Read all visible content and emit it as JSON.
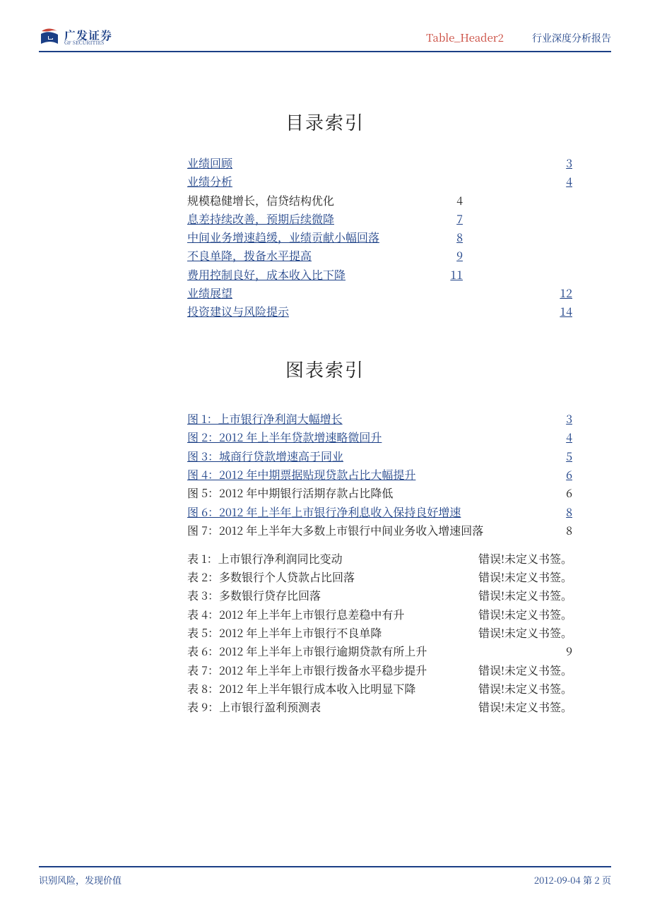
{
  "header": {
    "logo_cn": "广发证券",
    "logo_en": "GF SECURITIES",
    "table_tag": "Table_Header2",
    "category": "行业深度分析报告"
  },
  "titles": {
    "toc": "目录索引",
    "figs": "图表索引"
  },
  "toc_main": [
    {
      "label": "业绩回顾",
      "page": "3",
      "link": true,
      "wide": true
    },
    {
      "label": "业绩分析",
      "page": "4",
      "link": true,
      "wide": true
    }
  ],
  "toc_sub": [
    {
      "label": "规模稳健增长，信贷结构优化",
      "page": "4",
      "link": false
    },
    {
      "label": "息差持续改善，预期后续微降",
      "page": "7",
      "link": true
    },
    {
      "label": "中间业务增速趋缓，业绩贡献小幅回落",
      "page": "8",
      "link": true
    },
    {
      "label": "不良单降，拨备水平提高",
      "page": "9",
      "link": true
    },
    {
      "label": "费用控制良好，成本收入比下降",
      "page": "11",
      "link": true
    }
  ],
  "toc_tail": [
    {
      "label": "业绩展望",
      "page": "12",
      "link": true,
      "wide": true
    },
    {
      "label": "投资建议与风险提示",
      "page": "14",
      "link": true,
      "wide": true
    }
  ],
  "figures": [
    {
      "label": "图 1：上市银行净利润大幅增长",
      "page": "3",
      "link": true
    },
    {
      "label": "图 2：2012 年上半年贷款增速略微回升",
      "page": "4",
      "link": true
    },
    {
      "label": "图 3：城商行贷款增速高于同业",
      "page": "5",
      "link": true
    },
    {
      "label": "图 4：2012 年中期票据贴现贷款占比大幅提升",
      "page": "6",
      "link": true
    },
    {
      "label": "图 5：2012 年中期银行活期存款占比降低",
      "page": "6",
      "link": false
    },
    {
      "label": "图 6：2012 年上半年上市银行净利息收入保持良好增速",
      "page": "8",
      "link": true
    },
    {
      "label": "图 7：2012 年上半年大多数上市银行中间业务收入增速回落",
      "page": "8",
      "link": false
    }
  ],
  "tables": [
    {
      "label": "表 1：上市银行净利润同比变动",
      "page": "错误!未定义书签。",
      "link": false
    },
    {
      "label": "表 2：多数银行个人贷款占比回落",
      "page": "错误!未定义书签。",
      "link": false
    },
    {
      "label": "表 3：多数银行贷存比回落",
      "page": "错误!未定义书签。",
      "link": false
    },
    {
      "label": "表 4：2012 年上半年上市银行息差稳中有升",
      "page": "错误!未定义书签。",
      "link": false
    },
    {
      "label": "表 5：2012 年上半年上市银行不良单降",
      "page": "错误!未定义书签。",
      "link": false
    },
    {
      "label": "表 6：2012 年上半年上市银行逾期贷款有所上升",
      "page": "9",
      "link": false
    },
    {
      "label": "表 7：2012 年上半年上市银行拨备水平稳步提升",
      "page": "错误!未定义书签。",
      "link": false
    },
    {
      "label": "表 8：2012 年上半年银行成本收入比明显下降",
      "page": "错误!未定义书签。",
      "link": false
    },
    {
      "label": "表 9：上市银行盈利预测表",
      "page": "错误!未定义书签。",
      "link": false
    }
  ],
  "footer": {
    "left": "识别风险，发现价值",
    "right": "2012-09-04  第 2 页"
  }
}
